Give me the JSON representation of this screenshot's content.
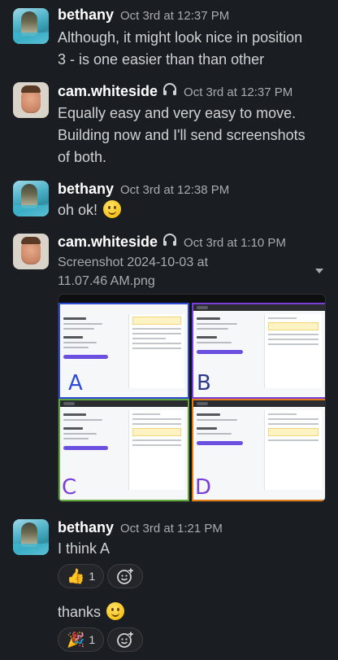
{
  "messages": [
    {
      "user": "bethany",
      "time": "Oct 3rd at 12:37 PM",
      "lines": [
        "Although, it might look nice in position",
        "3 - is one easier than than other"
      ]
    },
    {
      "user": "cam.whiteside",
      "time": "Oct 3rd at 12:37 PM",
      "lines": [
        "Equally easy and very easy to move.",
        "Building now and I'll send screenshots",
        "of both."
      ]
    },
    {
      "user": "bethany",
      "time": "Oct 3rd at 12:38 PM",
      "text": "oh ok!"
    },
    {
      "user": "cam.whiteside",
      "time": "Oct 3rd at 1:10 PM",
      "file_name_lines": [
        "Screenshot 2024-10-03 at",
        "11.07.46 AM.png"
      ],
      "variants": [
        {
          "letter": "A",
          "color": "#2d4bd4"
        },
        {
          "letter": "B",
          "color": "#7a3fd6"
        },
        {
          "letter": "C",
          "color": "#7a3fd6"
        },
        {
          "letter": "D",
          "color": "#e07a16"
        }
      ]
    },
    {
      "user": "bethany",
      "time": "Oct 3rd at 1:21 PM",
      "text": "I think A",
      "reaction": {
        "emoji": "👍",
        "count": "1"
      }
    },
    {
      "text": "thanks",
      "reaction": {
        "emoji": "🎉",
        "count": "1"
      }
    }
  ],
  "colors": {
    "background": "#1a1d21",
    "name": "#ffffff",
    "timestamp": "#a9abae",
    "body_text": "#d1d2d3"
  },
  "icons": {
    "headphones": "headphones-icon",
    "add_reaction": "add-reaction-icon",
    "file_menu": "chevron-down-icon"
  }
}
